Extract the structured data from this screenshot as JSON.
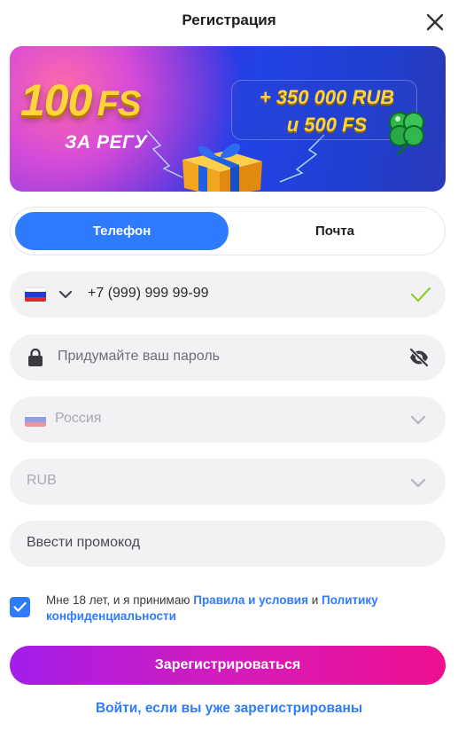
{
  "header": {
    "title": "Регистрация"
  },
  "banner": {
    "big_number": "100",
    "big_suffix": "FS",
    "subtitle": "ЗА РЕГУ",
    "bonus_line1": "+ 350 000 RUB",
    "bonus_line2": "и 500 FS"
  },
  "tabs": [
    {
      "label": "Телефон",
      "active": true
    },
    {
      "label": "Почта",
      "active": false
    }
  ],
  "form": {
    "phone_value": "+7 (999) 999 99-99",
    "password_placeholder": "Придумайте ваш пароль",
    "country_value": "Россия",
    "currency_value": "RUB",
    "promo_placeholder": "Ввести промокод"
  },
  "terms": {
    "prefix": "Мне 18 лет, и я принимаю ",
    "rules_link": "Правила и условия",
    "conjunction": " и ",
    "privacy_link": "Политику конфиденциальности",
    "checked": true
  },
  "buttons": {
    "submit_label": "Зарегистрироваться",
    "login_link": "Войти, если вы уже зарегистрированы"
  },
  "colors": {
    "accent": "#2f7bff",
    "success_check": "#8ccf2a",
    "submit_gradient_start": "#a31de9",
    "submit_gradient_end": "#ee0e8f",
    "field_background": "#f2f2f4"
  }
}
